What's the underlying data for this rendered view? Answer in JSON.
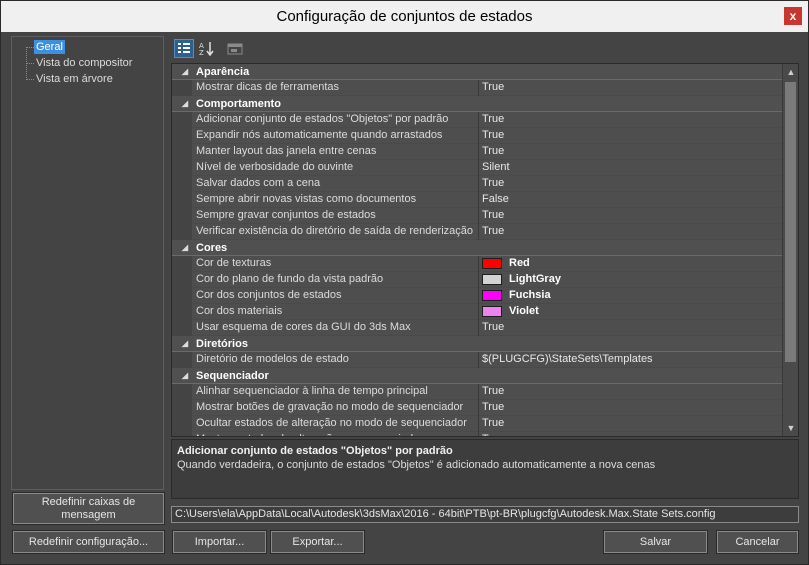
{
  "window": {
    "title": "Configuração de conjuntos de estados",
    "close_glyph": "x"
  },
  "tree": {
    "items": [
      {
        "label": "Geral",
        "selected": true
      },
      {
        "label": "Vista do compositor",
        "selected": false
      },
      {
        "label": "Vista em árvore",
        "selected": false
      }
    ]
  },
  "toolbar": {
    "icons": [
      "categorized-view-icon",
      "alphabetical-sort-icon",
      "property-pages-icon"
    ]
  },
  "grid": {
    "sections": [
      {
        "name": "Aparência",
        "props": [
          {
            "name": "Mostrar dicas de ferramentas",
            "value": "True"
          }
        ]
      },
      {
        "name": "Comportamento",
        "props": [
          {
            "name": "Adicionar conjunto de estados \"Objetos\" por padrão",
            "value": "True"
          },
          {
            "name": "Expandir nós automaticamente quando arrastados",
            "value": "True"
          },
          {
            "name": "Manter layout das janela entre cenas",
            "value": "True"
          },
          {
            "name": "Nível de verbosidade do ouvinte",
            "value": "Silent"
          },
          {
            "name": "Salvar dados com a cena",
            "value": "True"
          },
          {
            "name": "Sempre abrir novas vistas como documentos",
            "value": "False"
          },
          {
            "name": "Sempre gravar conjuntos de estados",
            "value": "True"
          },
          {
            "name": "Verificar existência do diretório de saída de renderização",
            "value": "True"
          }
        ]
      },
      {
        "name": "Cores",
        "props": [
          {
            "name": "Cor de texturas",
            "value": "Red",
            "color": "#ff0000"
          },
          {
            "name": "Cor do plano de fundo da vista padrão",
            "value": "LightGray",
            "color": "#d3d3d3"
          },
          {
            "name": "Cor dos conjuntos de estados",
            "value": "Fuchsia",
            "color": "#ff00ff"
          },
          {
            "name": "Cor dos materiais",
            "value": "Violet",
            "color": "#ee82ee"
          },
          {
            "name": "Usar esquema de cores da GUI do 3ds Max",
            "value": "True"
          }
        ]
      },
      {
        "name": "Diretórios",
        "props": [
          {
            "name": "Diretório de modelos de estado",
            "value": "$(PLUGCFG)\\StateSets\\Templates"
          }
        ]
      },
      {
        "name": "Sequenciador",
        "props": [
          {
            "name": "Alinhar sequenciador à linha de tempo principal",
            "value": "True"
          },
          {
            "name": "Mostrar botões de gravação no modo de sequenciador",
            "value": "True"
          },
          {
            "name": "Ocultar estados de alteração no modo de sequenciador",
            "value": "True"
          },
          {
            "name": "Mostrar estados de alteração no sequenciador",
            "value": "True"
          }
        ]
      }
    ]
  },
  "description": {
    "title": "Adicionar conjunto de estados \"Objetos\" por padrão",
    "text": "Quando verdadeira, o conjunto de estados \"Objetos\" é adicionado automaticamente a nova cenas"
  },
  "path": "C:\\Users\\ela\\AppData\\Local\\Autodesk\\3dsMax\\2016 - 64bit\\PTB\\pt-BR\\plugcfg\\Autodesk.Max.State Sets.config",
  "buttons": {
    "reset_dialogs": "Redefinir caixas de mensagem",
    "reset_config": "Redefinir configuração...",
    "import": "Importar...",
    "export": "Exportar...",
    "save": "Salvar",
    "cancel": "Cancelar"
  }
}
